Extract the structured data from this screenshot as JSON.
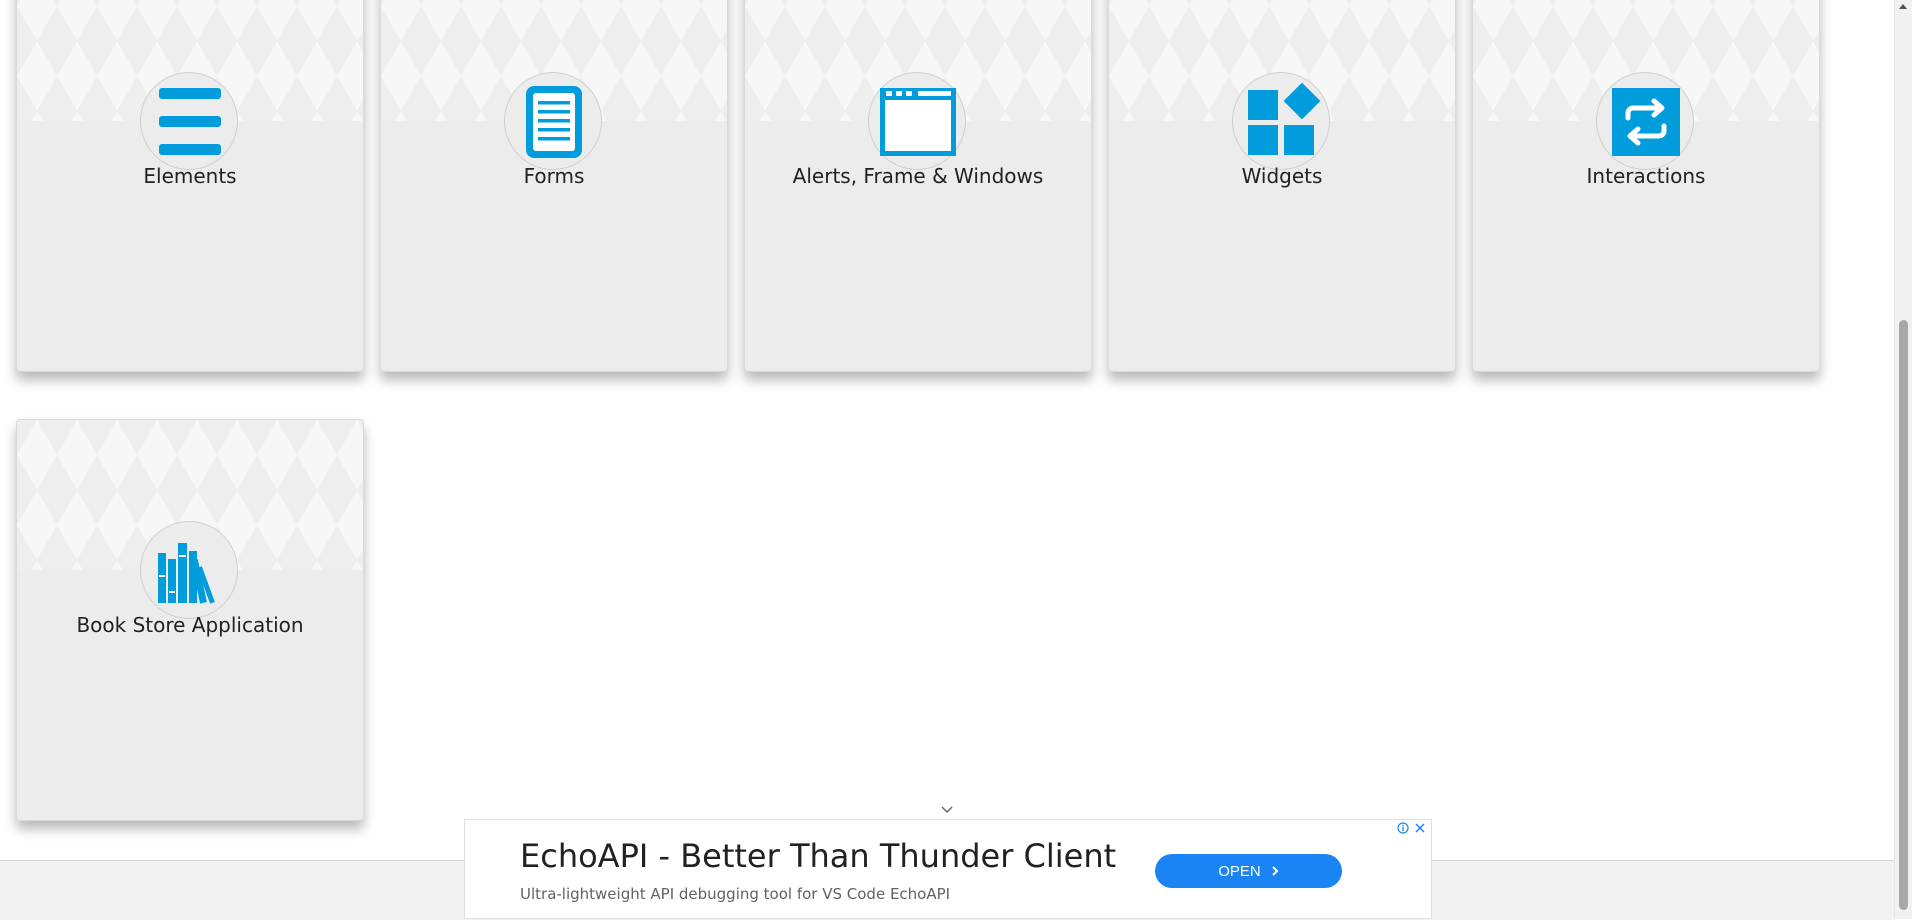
{
  "cards": [
    {
      "label": "Elements",
      "icon": "elements-icon"
    },
    {
      "label": "Forms",
      "icon": "forms-icon"
    },
    {
      "label": "Alerts, Frame & Windows",
      "icon": "alerts-window-icon"
    },
    {
      "label": "Widgets",
      "icon": "widgets-icon"
    },
    {
      "label": "Interactions",
      "icon": "interactions-icon"
    },
    {
      "label": "Book Store Application",
      "icon": "bookstore-icon"
    }
  ],
  "ad": {
    "title": "EchoAPI - Better Than Thunder Client",
    "description": "Ultra-lightweight API debugging tool for VS Code EchoAPI",
    "button_label": "OPEN"
  },
  "colors": {
    "accent": "#009cdc",
    "ad_button": "#1a84f5"
  }
}
